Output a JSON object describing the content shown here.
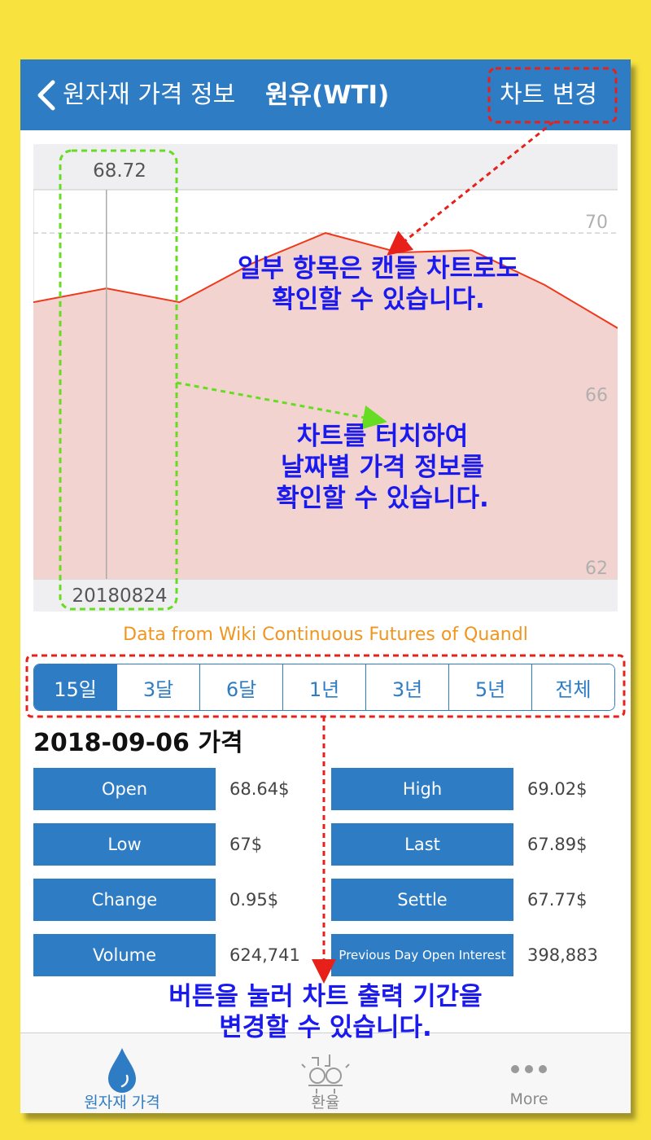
{
  "navbar": {
    "back_label": "원자재 가격 정보",
    "title": "원유(WTI)",
    "action_label": "차트 변경"
  },
  "chart": {
    "tooltip_value": "68.72",
    "tooltip_date": "20180824"
  },
  "chart_data": {
    "type": "area",
    "title": "",
    "xlabel": "",
    "ylabel": "",
    "ylim": [
      62,
      71.0
    ],
    "y_ticks": [
      "70",
      "66",
      "62"
    ],
    "grid": true,
    "series": [
      {
        "values": [
          68.4,
          68.72,
          68.4,
          69.3,
          70.0,
          69.55,
          69.6,
          68.8,
          67.8
        ]
      }
    ],
    "colors": {
      "line": "#f0391c",
      "fill": "#f3d3cf",
      "background": "#efeff1",
      "crosshair": "#aaaaaa"
    }
  },
  "source": "Data from Wiki Continuous Futures of Quandl",
  "periods": [
    "15일",
    "3달",
    "6달",
    "1년",
    "3년",
    "5년",
    "전체"
  ],
  "active_period": 0,
  "details": {
    "heading": "2018-09-06 가격",
    "rows": [
      {
        "left_label": "Open",
        "left_value": "68.64$",
        "right_label": "High",
        "right_value": "69.02$"
      },
      {
        "left_label": "Low",
        "left_value": "67$",
        "right_label": "Last",
        "right_value": "67.89$"
      },
      {
        "left_label": "Change",
        "left_value": "0.95$",
        "right_label": "Settle",
        "right_value": "67.77$"
      },
      {
        "left_label": "Volume",
        "left_value": "624,741",
        "right_label": "Previous Day Open Interest",
        "right_value": "398,883"
      }
    ]
  },
  "tabs": [
    {
      "label": "원자재 가격",
      "icon": "drop-icon",
      "active": true
    },
    {
      "label": "환율",
      "icon": "exchange-icon",
      "active": false
    },
    {
      "label": "More",
      "icon": "more-dots-icon",
      "active": false
    }
  ],
  "annotations": {
    "candle": [
      "일부 항목은 캔들 차트로도",
      "확인할 수 있습니다."
    ],
    "touch": [
      "차트를 터치하여",
      "날짜별 가격 정보를",
      "확인할 수 있습니다."
    ],
    "period": [
      "버튼을 눌러 차트 출력 기간을",
      "변경할 수 있습니다."
    ]
  },
  "colors": {
    "background": "#f7e23e",
    "accent": "#2e7cc4",
    "source_text": "#f0951e",
    "annotation_text": "#1a1aee",
    "red_highlight": "#e8201a",
    "green_highlight": "#66dd22"
  }
}
